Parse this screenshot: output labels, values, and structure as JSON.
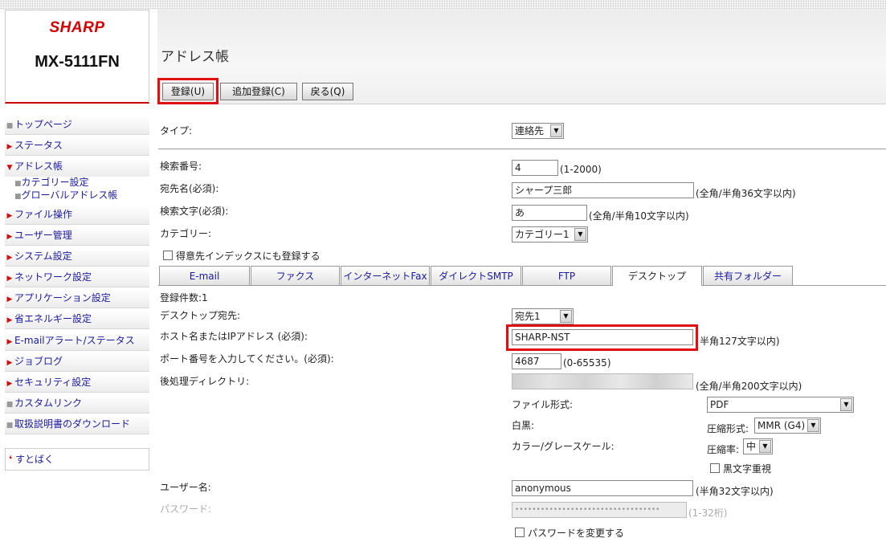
{
  "brand": {
    "logo": "SHARP",
    "model": "MX-5111FN"
  },
  "header": {
    "title": "アドレス帳",
    "buttons": {
      "register": "登録(U)",
      "add_register": "追加登録(C)",
      "back": "戻る(Q)"
    }
  },
  "sidebar": {
    "items": [
      {
        "label": "トップページ",
        "icon": "square-bullet-icon"
      },
      {
        "label": "ステータス",
        "icon": "arrow-right-icon"
      },
      {
        "label": "アドレス帳",
        "icon": "arrow-down-icon"
      },
      {
        "label": "ファイル操作",
        "icon": "arrow-right-icon"
      },
      {
        "label": "ユーザー管理",
        "icon": "arrow-right-icon"
      },
      {
        "label": "システム設定",
        "icon": "arrow-right-icon"
      },
      {
        "label": "ネットワーク設定",
        "icon": "arrow-right-icon"
      },
      {
        "label": "アプリケーション設定",
        "icon": "arrow-right-icon"
      },
      {
        "label": "省エネルギー設定",
        "icon": "arrow-right-icon"
      },
      {
        "label": "E-mailアラート/ステータス",
        "icon": "arrow-right-icon"
      },
      {
        "label": "ジョブログ",
        "icon": "arrow-right-icon"
      },
      {
        "label": "セキュリティ設定",
        "icon": "arrow-right-icon"
      },
      {
        "label": "カスタムリンク",
        "icon": "square-bullet-icon"
      },
      {
        "label": "取扱説明書のダウンロード",
        "icon": "square-bullet-icon"
      }
    ],
    "subitems": [
      "カテゴリー設定",
      "グローバルアドレス帳"
    ],
    "sutobaku": "すとばく"
  },
  "form": {
    "type_label": "タイプ:",
    "type_value": "連絡先",
    "search_no_label": "検索番号:",
    "search_no_value": "4",
    "search_no_hint": "(1-2000)",
    "name_label": "宛先名(必須):",
    "name_value": "シャープ三郎",
    "name_hint": "(全角/半角36文字以内)",
    "search_char_label": "検索文字(必須):",
    "search_char_value": "あ",
    "search_char_hint": "(全角/半角10文字以内)",
    "category_label": "カテゴリー:",
    "category_value": "カテゴリー1",
    "favorite_label": "得意先インデックスにも登録する",
    "tabs": [
      "E-mail",
      "ファクス",
      "インターネットFax",
      "ダイレクトSMTP",
      "FTP",
      "デスクトップ",
      "共有フォルダー"
    ],
    "count_label": "登録件数:1",
    "dest_label": "デスクトップ宛先:",
    "dest_value": "宛先1",
    "host_label": "ホスト名またはIPアドレス (必須):",
    "host_value": "SHARP-NST",
    "host_hint": "半角127文字以内)",
    "port_label": "ポート番号を入力してください。(必須):",
    "port_value": "4687",
    "port_hint": "(0-65535)",
    "postdir_label": "後処理ディレクトリ:",
    "postdir_hint": "(全角/半角200文字以内)",
    "filetype_label": "ファイル形式:",
    "filetype_value": "PDF",
    "bw_label": "白黒:",
    "compress_mode_label": "圧縮形式:",
    "compress_mode_value": "MMR (G4)",
    "color_label": "カラー/グレースケール:",
    "compress_rate_label": "圧縮率:",
    "compress_rate_value": "中",
    "black_text_label": "黒文字重視",
    "user_label": "ユーザー名:",
    "user_value": "anonymous",
    "user_hint": "(半角32文字以内)",
    "password_label": "パスワード:",
    "password_value": "••••••••••••••••••••••••••••••••••",
    "password_hint": "(1-32桁)",
    "change_pw_label": "パスワードを変更する"
  },
  "colors": {
    "accent_red": "#e01010",
    "link_blue": "#1a1aa0",
    "brand_red": "#d40000"
  }
}
